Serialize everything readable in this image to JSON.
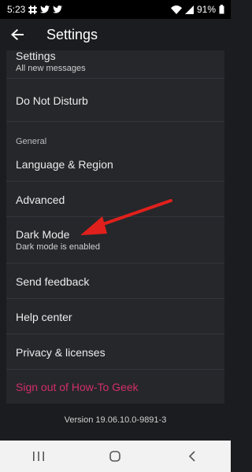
{
  "status_bar": {
    "time": "5:23",
    "battery": "91%"
  },
  "app_bar": {
    "title": "Settings"
  },
  "rows": {
    "notifications": {
      "title": "Settings",
      "subtitle": "All new messages"
    },
    "dnd": {
      "title": "Do Not Disturb"
    },
    "general_header": "General",
    "language": {
      "title": "Language & Region"
    },
    "advanced": {
      "title": "Advanced"
    },
    "dark_mode": {
      "title": "Dark Mode",
      "subtitle": "Dark mode is enabled"
    },
    "feedback": {
      "title": "Send feedback"
    },
    "help": {
      "title": "Help center"
    },
    "privacy": {
      "title": "Privacy & licenses"
    },
    "signout": {
      "title": "Sign out of How-To Geek"
    }
  },
  "version": "Version 19.06.10.0-9891-3",
  "colors": {
    "signout": "#d22e66",
    "annotation_arrow": "#e0201c",
    "panel": "#26272b"
  }
}
